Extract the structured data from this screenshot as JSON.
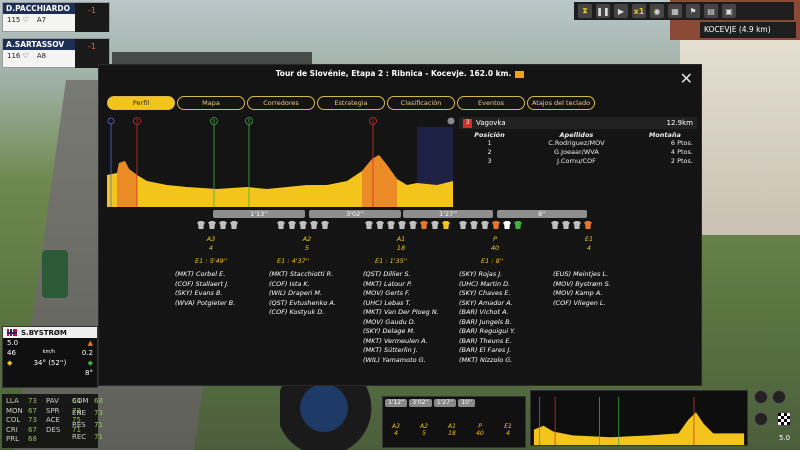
{
  "riders_top": [
    {
      "name": "D.PACCHIARDO",
      "energy": "115",
      "team_pos": "A7",
      "count": "-1",
      "count2": "30"
    },
    {
      "name": "A.SARTASSOV",
      "energy": "116",
      "team_pos": "A8",
      "count": "-1",
      "count2": "32"
    }
  ],
  "topbar": {
    "speed": "x1"
  },
  "location": "KOCEVJE (4.9 km)",
  "modal": {
    "title": "Tour de Slovénie, Etapa 2 : Ribnica  -  Kocevje. 162.0 km.",
    "tabs": [
      "Perfil",
      "Mapa",
      "Corredores",
      "Estrategia",
      "Clasificación",
      "Eventos",
      "Atajos del teclado"
    ],
    "active_tab": "Perfil",
    "profile_markers": [
      "3",
      "5",
      "5",
      "1"
    ],
    "climb": {
      "number": "3",
      "name": "Vagovka",
      "distance": "12.9km",
      "headers": [
        "Posición",
        "Apellidos",
        "Montaña"
      ],
      "rows": [
        {
          "pos": "1",
          "name": "C.Rodriguez/MOV",
          "pts": "6 Ptos."
        },
        {
          "pos": "2",
          "name": "G.Joeaar/WVA",
          "pts": "4 Ptos."
        },
        {
          "pos": "3",
          "name": "J.Cornu/COF",
          "pts": "2 Ptos."
        }
      ]
    },
    "gaps": [
      "1'13''",
      "3'02''",
      "1'27''",
      "8''"
    ],
    "checkpoints": [
      {
        "label": "A3",
        "value": "4"
      },
      {
        "label": "A2",
        "value": "5"
      },
      {
        "label": "A1",
        "value": "18"
      },
      {
        "label": "P",
        "value": "40"
      },
      {
        "label": "E1",
        "value": "4"
      }
    ],
    "groups": [
      {
        "time": "E1 : 5'49''",
        "riders": [
          "(MKT) Corbel E.",
          "(COF) Stallaert J.",
          "(SKY) Evans B.",
          "(WVA) Potgieter B."
        ]
      },
      {
        "time": "E1 : 4'37''",
        "riders": [
          "(MKT) Stacchiotti R.",
          "(COF) Ista K.",
          "(WIL) Draperi M.",
          "(QST) Evtushenko A.",
          "(COF) Kostyuk D."
        ]
      },
      {
        "time": "E1 : 1'35''",
        "riders": [
          "(QST) Dillier S.",
          "(MKT) Latour P.",
          "(MOV) Gerts F.",
          "(UHC) Lebas T.",
          "(MKT) Van Der Ploeg N.",
          "(MOV) Gaudu D.",
          "(SKY) Delage M.",
          "(MKT) Vermeulen A.",
          "(MKT) Sütterlin J.",
          "(WIL) Yamamoto G."
        ]
      },
      {
        "time": "E1 : 8''",
        "riders": [
          "(SKY) Rojas J.",
          "(UHC) Martin D.",
          "(SKY) Chaves E.",
          "(SKY) Amador A.",
          "(BAR) Vichot A.",
          "(BAR) Jungels B.",
          "(BAR) Reguigui Y.",
          "(BAR) Theuns E.",
          "(BAR) El Fares J.",
          "(MKT) Nizzolo G."
        ]
      },
      {
        "time": "",
        "riders": [
          "(EUS) Meintjes L.",
          "(MOV) Bystrøm S.",
          "(MOV) Kamp A.",
          "(COF) Vliegen L."
        ]
      }
    ]
  },
  "rider_panel": {
    "name": "S.BYSTRØM",
    "power": "5.0",
    "power_unit": "",
    "speed": "46",
    "speed_unit": "km/h",
    "gradient": "0.2",
    "temp": "34° (52'')",
    "pos": "8°"
  },
  "attributes": [
    {
      "k": "LLA",
      "v": "73",
      "k2": "PAV",
      "v2": "64"
    },
    {
      "k": "MON",
      "v": "67",
      "k2": "SPR",
      "v2": "73"
    },
    {
      "k": "COL",
      "v": "73",
      "k2": "ACE",
      "v2": "75"
    },
    {
      "k": "CRI",
      "v": "67",
      "k2": "DES",
      "v2": "71"
    },
    {
      "k": "PRL",
      "v": "68",
      "k2": "",
      "v2": ""
    }
  ],
  "attributes2": [
    {
      "k": "COM",
      "v": "68"
    },
    {
      "k": "ENE",
      "v": "73"
    },
    {
      "k": "RES",
      "v": "71"
    },
    {
      "k": "REC",
      "v": "71"
    }
  ],
  "bottom": {
    "gaps": [
      "1'12''",
      "3'02''",
      "1'27''",
      "10''"
    ],
    "cps": [
      {
        "l": "A3",
        "v": "4"
      },
      {
        "l": "A2",
        "v": "5"
      },
      {
        "l": "A1",
        "v": "18"
      },
      {
        "l": "P",
        "v": "40"
      },
      {
        "l": "E1",
        "v": "4"
      }
    ],
    "zoom": "5.0"
  }
}
